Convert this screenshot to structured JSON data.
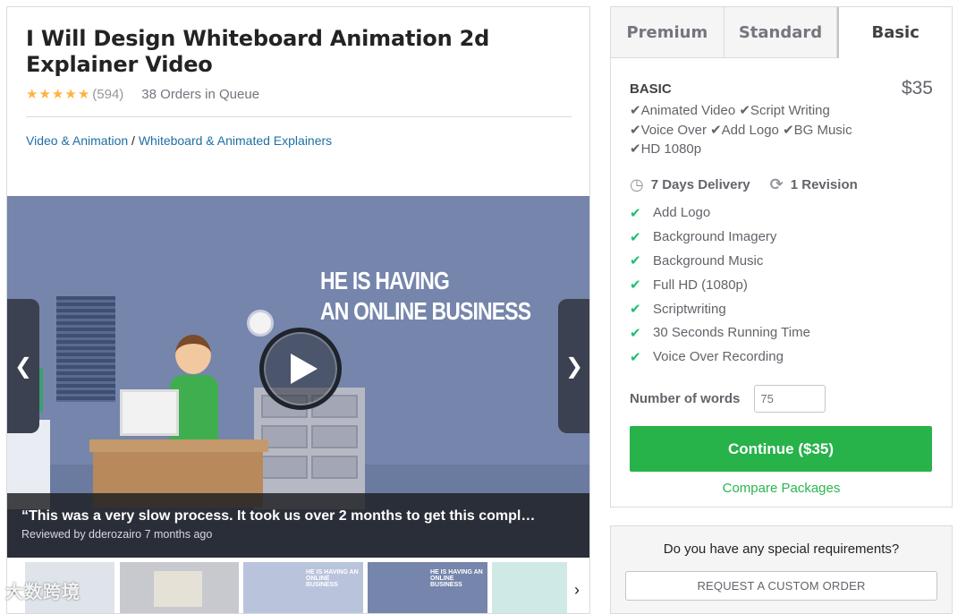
{
  "gig": {
    "title": "I Will Design Whiteboard Animation 2d Explainer Video",
    "rating_stars": 5,
    "rating_count": "(594)",
    "orders_in_queue": "38 Orders in Queue",
    "breadcrumb": {
      "category": "Video & Animation",
      "separator": " / ",
      "subcategory": "Whiteboard & Animated Explainers"
    }
  },
  "video": {
    "headline_line1": "HE IS HAVING",
    "headline_line2": "AN ONLINE BUSINESS",
    "review_quote": "“This was a very slow process. It took us over 2 months to get this compl…",
    "review_meta": "Reviewed by dderozairo 7 months ago"
  },
  "thumbnails": [
    {
      "caption": ""
    },
    {
      "caption": ""
    },
    {
      "caption": "HE IS HAVING AN ONLINE BUSINESS"
    },
    {
      "caption": "HE IS HAVING AN ONLINE BUSINESS"
    },
    {
      "caption": ""
    }
  ],
  "watermark": "大数跨境",
  "packages": {
    "tabs": [
      "Premium",
      "Standard",
      "Basic"
    ],
    "active_tab": "Basic",
    "name": "BASIC",
    "price": "$35",
    "description_lines": [
      "✔Animated Video ✔Script Writing",
      "✔Voice Over ✔Add Logo ✔BG Music",
      "✔HD 1080p"
    ],
    "delivery": "7 Days Delivery",
    "revision": "1 Revision",
    "features": [
      "Add Logo",
      "Background Imagery",
      "Background Music",
      "Full HD (1080p)",
      "Scriptwriting",
      "30 Seconds Running Time",
      "Voice Over Recording"
    ],
    "words_label": "Number of words",
    "words_placeholder": "75",
    "continue_label": "Continue ($35)",
    "compare_label": "Compare Packages"
  },
  "requirements": {
    "question": "Do you have any special requirements?",
    "button_label": "REQUEST A CUSTOM ORDER"
  },
  "colors": {
    "accent_green": "#27b24a",
    "link_blue": "#1d6fa5",
    "star": "#ffb33e"
  }
}
